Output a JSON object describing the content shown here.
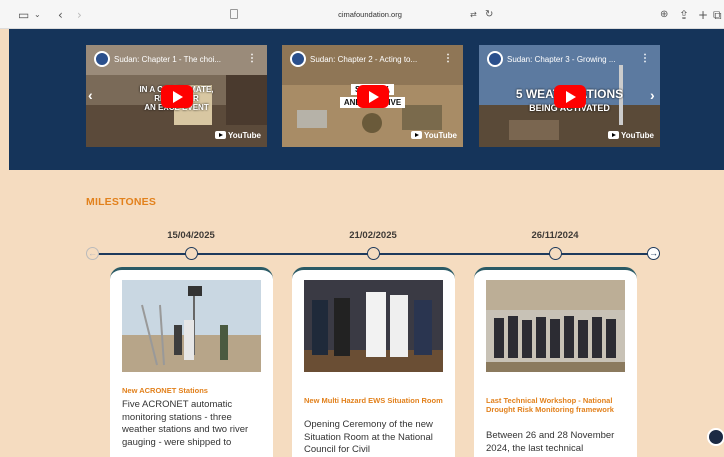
{
  "browser": {
    "url": "cimafoundation.org"
  },
  "videos": [
    {
      "title": "Sudan: Chapter 1 - The choi...",
      "caption_lines": [
        "IN A CHA  CLIMATE,",
        "RISK  NGER",
        "AN EXCE  EVENT"
      ],
      "brand": "YouTube"
    },
    {
      "title": "Sudan: Chapter 2 - Acting to...",
      "caption_lines": [
        "SHA  ELY,",
        "AND M  LUSIVE"
      ],
      "brand": "YouTube"
    },
    {
      "title": "Sudan: Chapter 3 - Growing ...",
      "caption_lines": [
        "5 WEATH  TATIONS",
        "BEING ACTIVATED"
      ],
      "brand": "YouTube"
    }
  ],
  "milestones": {
    "heading": "MILESTONES",
    "items": [
      {
        "date": "15/04/2025",
        "title": "New ACRONET Stations",
        "text": "Five ACRONET automatic monitoring stations - three weather stations and two river gauging - were shipped to"
      },
      {
        "date": "21/02/2025",
        "title": "New Multi Hazard EWS Situation Room",
        "text": "Opening Ceremony of the new Situation Room at the National Council for Civil"
      },
      {
        "date": "26/11/2024",
        "title": "Last Technical Workshop - National Drought Risk Monitoring framework",
        "text": "Between 26 and 28 November 2024, the last technical"
      }
    ]
  },
  "colors": {
    "hero_bg": "#15345a",
    "page_bg": "#f5dcc0",
    "accent": "#e2811c",
    "timeline": "#1e3a5c"
  }
}
